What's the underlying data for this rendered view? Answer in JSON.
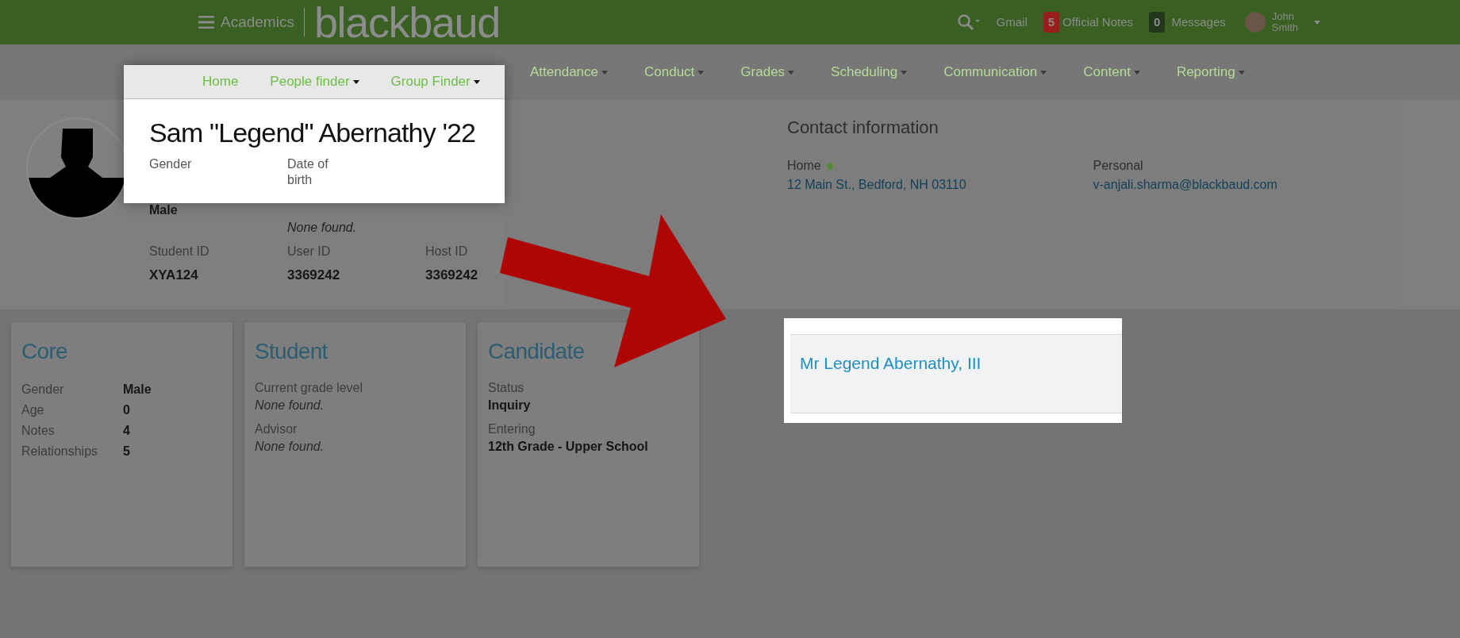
{
  "top_bar": {
    "app": "Academics",
    "logo": "blackbaud",
    "gmail": "Gmail",
    "notes": {
      "count": "5",
      "label": "Official Notes"
    },
    "messages": {
      "count": "0",
      "label": "Messages"
    },
    "user": {
      "first": "John",
      "last": "Smith"
    }
  },
  "nav": [
    {
      "label": "Home",
      "dropdown": false,
      "spotlight": true
    },
    {
      "label": "People finder",
      "dropdown": true,
      "spotlight": true
    },
    {
      "label": "Group Finder",
      "dropdown": true,
      "spotlight": true
    },
    {
      "label": "Attendance",
      "dropdown": true,
      "spotlight": false
    },
    {
      "label": "Conduct",
      "dropdown": true,
      "spotlight": false
    },
    {
      "label": "Grades",
      "dropdown": true,
      "spotlight": false
    },
    {
      "label": "Scheduling",
      "dropdown": true,
      "spotlight": false
    },
    {
      "label": "Communication",
      "dropdown": true,
      "spotlight": false
    },
    {
      "label": "Content",
      "dropdown": true,
      "spotlight": false
    },
    {
      "label": "Reporting",
      "dropdown": true,
      "spotlight": false
    }
  ],
  "profile": {
    "name": "Sam \"Legend\" Abernathy '22",
    "fields": [
      {
        "label": "Gender",
        "value": "Male",
        "empty": false
      },
      {
        "label": "Date of birth",
        "value": "None found.",
        "empty": true
      }
    ],
    "ids": [
      {
        "label": "Student ID",
        "value": "XYA124"
      },
      {
        "label": "User ID",
        "value": "3369242"
      },
      {
        "label": "Host ID",
        "value": "3369242"
      }
    ]
  },
  "contact": {
    "title": "Contact information",
    "items": [
      {
        "label": "Home",
        "starred": true,
        "value": "12 Main St., Bedford, NH 03110"
      },
      {
        "label": "Personal",
        "starred": false,
        "value": "v-anjali.sharma@blackbaud.com"
      }
    ]
  },
  "cards": [
    {
      "title": "Core",
      "kind": "table",
      "rows": [
        {
          "label": "Gender",
          "value": "Male",
          "empty": false
        },
        {
          "label": "Age",
          "value": "0",
          "empty": false
        },
        {
          "label": "Notes",
          "value": "4",
          "empty": false
        },
        {
          "label": "Relationships",
          "value": "5",
          "empty": false
        }
      ]
    },
    {
      "title": "Student",
      "kind": "stack",
      "rows": [
        {
          "label": "Current grade level",
          "value": "None found.",
          "empty": true
        },
        {
          "label": "Advisor",
          "value": "None found.",
          "empty": true
        }
      ]
    },
    {
      "title": "Candidate",
      "kind": "stack",
      "rows": [
        {
          "label": "Status",
          "value": "Inquiry",
          "empty": false
        },
        {
          "label": "Entering",
          "value": "12th Grade - Upper School",
          "empty": false
        }
      ]
    }
  ],
  "callout": {
    "name": "Mr Legend Abernathy, III"
  }
}
